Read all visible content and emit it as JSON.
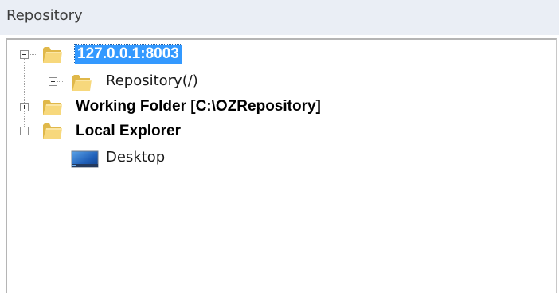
{
  "panel": {
    "title": "Repository"
  },
  "tree": {
    "nodes": [
      {
        "label": "127.0.0.1:8003",
        "expander": "minus",
        "icon": "folder-icon",
        "selected": true
      },
      {
        "label": "Repository(/)",
        "expander": "plus",
        "icon": "folder-icon",
        "selected": false
      },
      {
        "label": "Working Folder [C:\\OZRepository]",
        "expander": "plus",
        "icon": "folder-icon",
        "selected": false
      },
      {
        "label": "Local Explorer",
        "expander": "minus",
        "icon": "folder-icon",
        "selected": false
      },
      {
        "label": "Desktop",
        "expander": "plus",
        "icon": "desktop-icon",
        "selected": false
      }
    ]
  },
  "colors": {
    "header_bg": "#eaeef5",
    "selection": "#3399ff",
    "folder": "#f2d072",
    "tree_lines": "#a0a0a0"
  }
}
